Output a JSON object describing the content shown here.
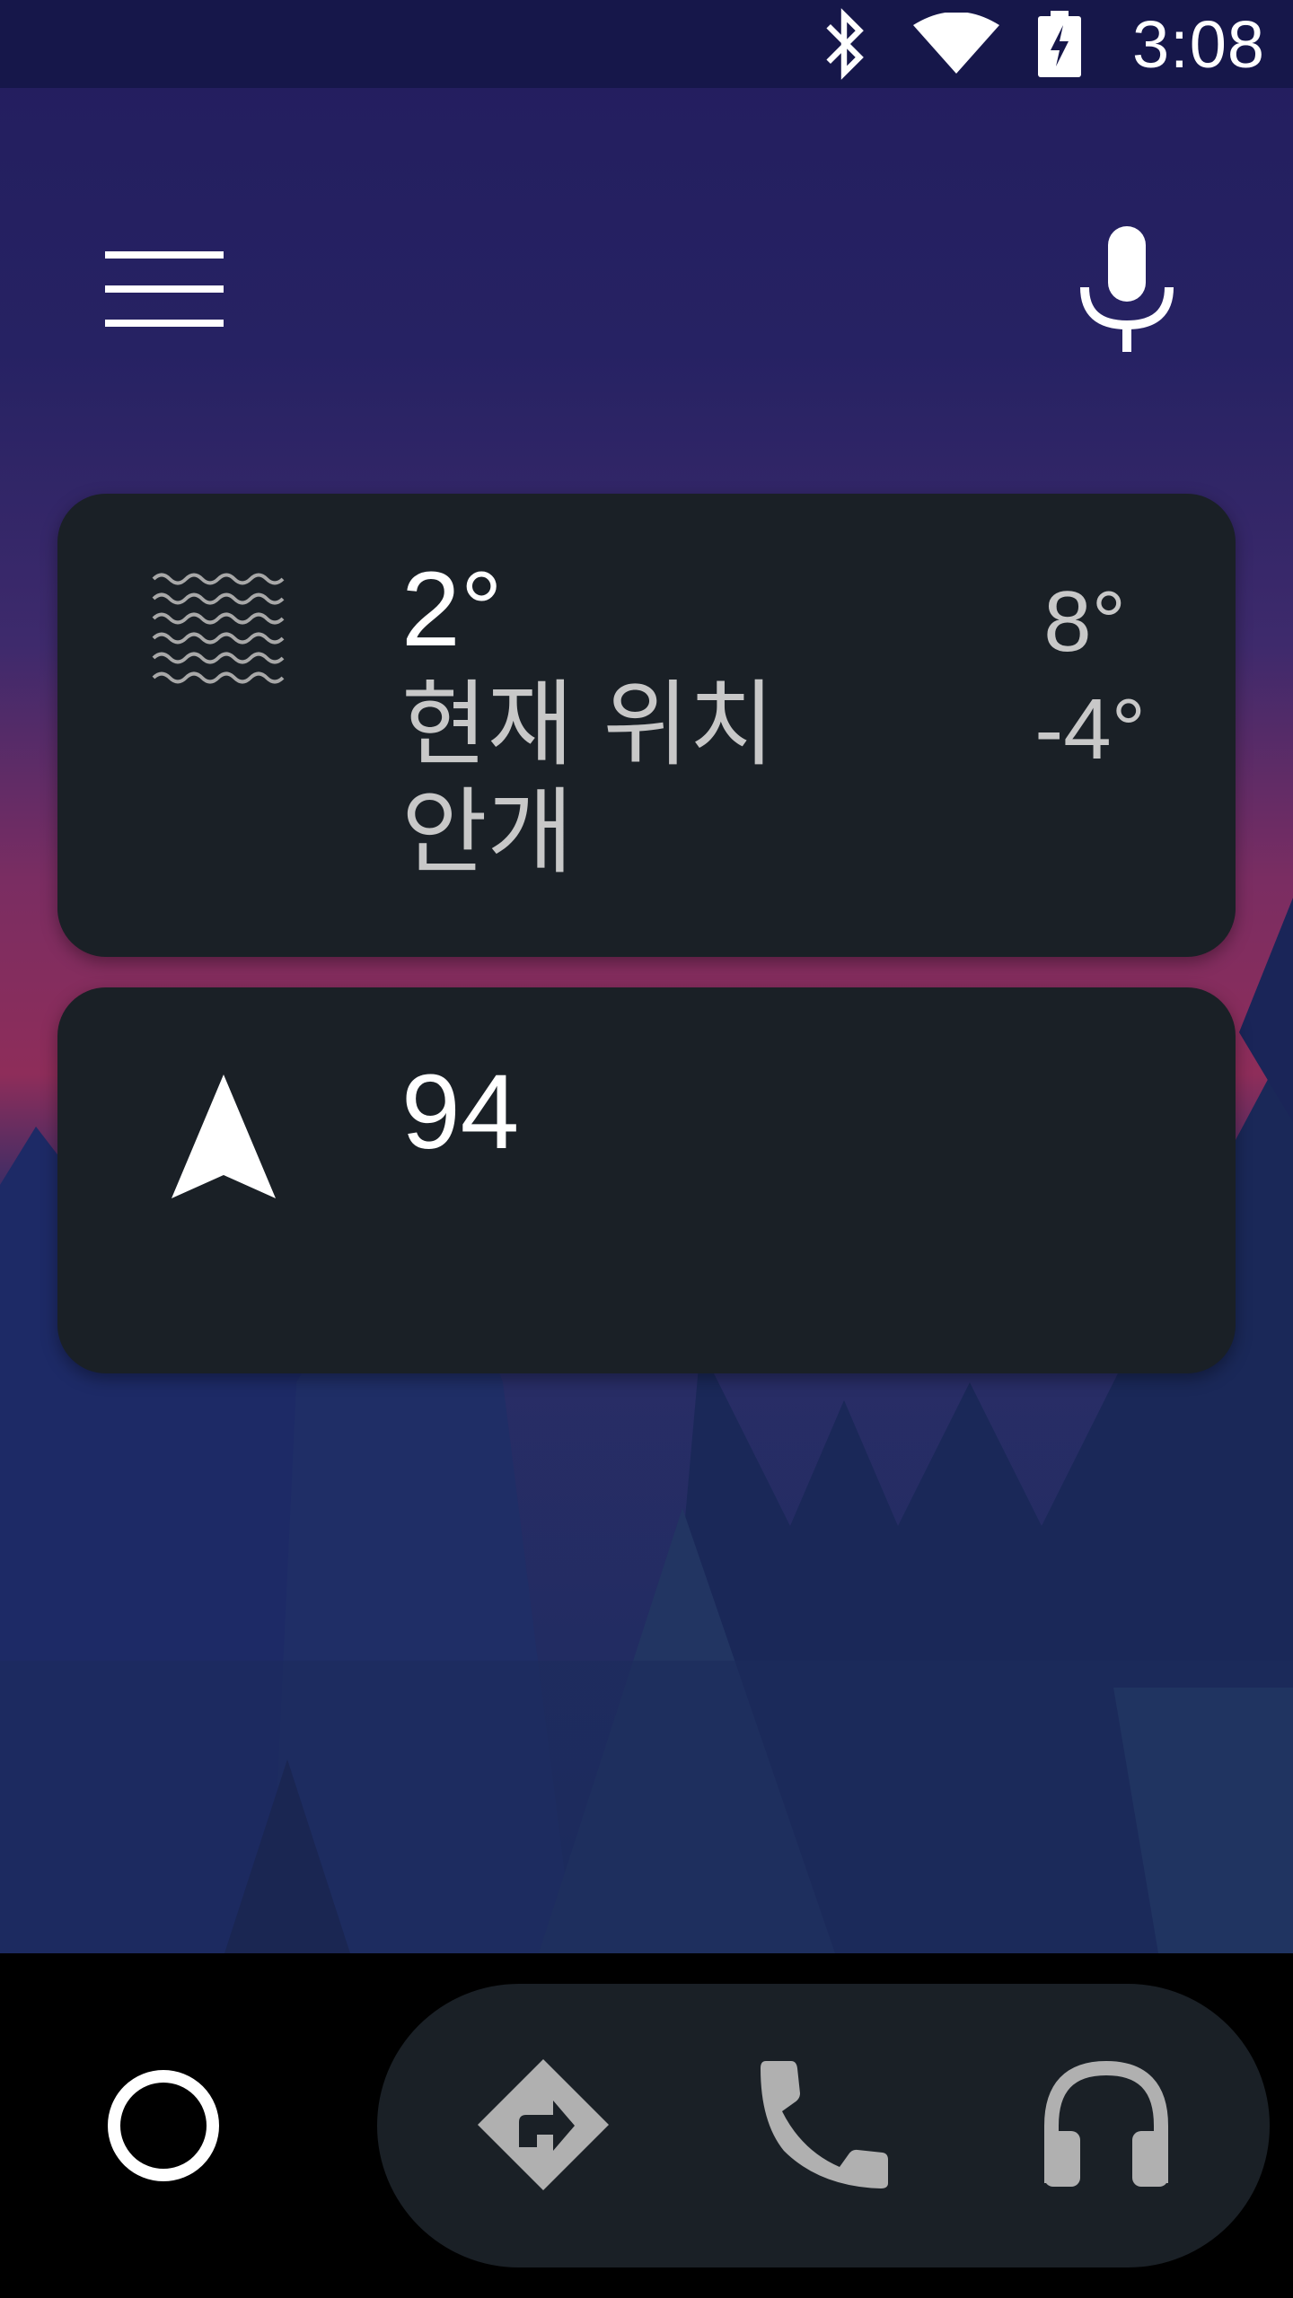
{
  "status_bar": {
    "time": "3:08",
    "icons": [
      "bluetooth-icon",
      "wifi-icon",
      "battery-charging-icon"
    ]
  },
  "app_bar": {
    "menu_icon": "menu-icon",
    "voice_icon": "microphone-icon"
  },
  "weather_card": {
    "icon": "fog-icon",
    "current_temp": "2°",
    "location": "현재 위치",
    "condition": "안개",
    "high": "8°",
    "low": "-4°"
  },
  "navigation_card": {
    "icon": "navigation-arrow-icon",
    "value": "94"
  },
  "bottom_nav": {
    "home_icon": "home-circle-icon",
    "items": [
      "navigation-icon",
      "phone-icon",
      "headphones-icon"
    ]
  },
  "colors": {
    "card_bg": "#1a2026",
    "status_bar_bg": "#16174a",
    "icon_gray": "#b0b0b0"
  }
}
